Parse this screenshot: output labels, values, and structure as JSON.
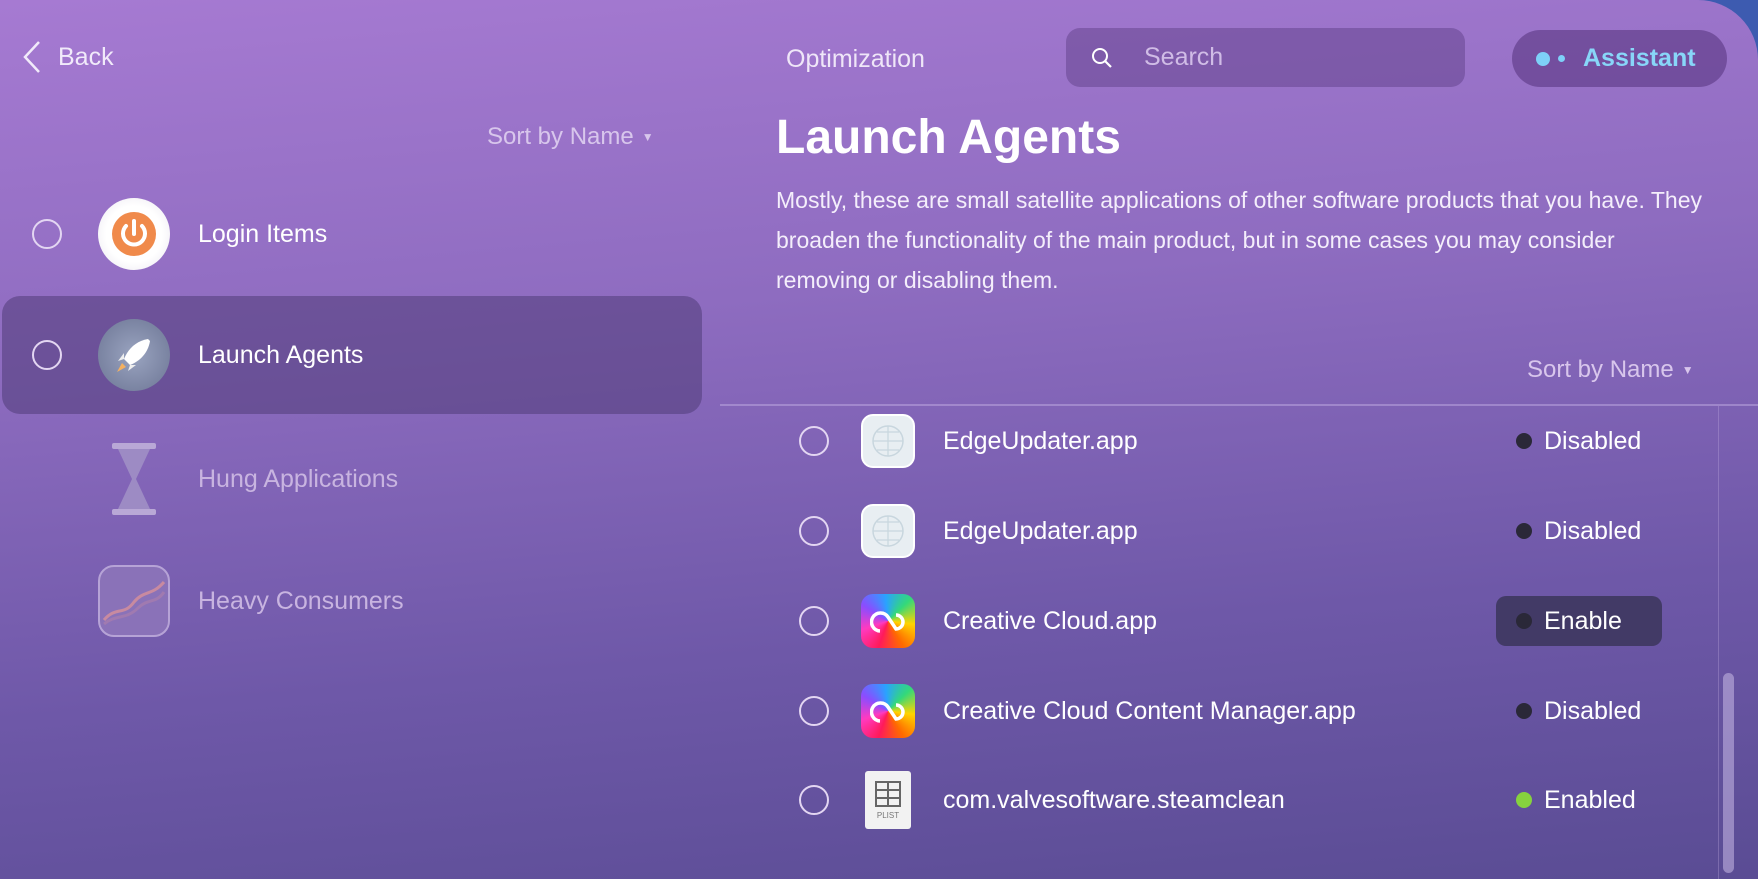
{
  "header": {
    "back_label": "Back",
    "section": "Optimization",
    "search_placeholder": "Search",
    "assistant_label": "Assistant"
  },
  "sidebar": {
    "sort_label": "Sort by Name",
    "items": [
      {
        "label": "Login Items",
        "icon": "power-icon",
        "selected": false,
        "dimmed": false
      },
      {
        "label": "Launch Agents",
        "icon": "rocket-icon",
        "selected": true,
        "dimmed": false
      },
      {
        "label": "Hung Applications",
        "icon": "hourglass-icon",
        "selected": false,
        "dimmed": true
      },
      {
        "label": "Heavy Consumers",
        "icon": "chart-icon",
        "selected": false,
        "dimmed": true
      }
    ]
  },
  "main": {
    "title": "Launch Agents",
    "description": "Mostly, these are small satellite applications of other software products that you have. They broaden the functionality of the main product, but in some cases you may consider removing or disabling them.",
    "sort_label": "Sort by Name",
    "items": [
      {
        "name": "EdgeUpdater.app",
        "status": "Disabled",
        "icon": "edge-updater-icon"
      },
      {
        "name": "EdgeUpdater.app",
        "status": "Disabled",
        "icon": "edge-updater-icon"
      },
      {
        "name": "Creative Cloud.app",
        "status": "Enable",
        "icon": "creative-cloud-icon"
      },
      {
        "name": "Creative Cloud Content Manager.app",
        "status": "Disabled",
        "icon": "creative-cloud-icon"
      },
      {
        "name": "com.valvesoftware.steamclean",
        "status": "Enabled",
        "icon": "plist-file-icon",
        "plist_label": "PLIST"
      }
    ]
  },
  "colors": {
    "enabled": "#86d23e",
    "disabled": "#2a2838",
    "assistant": "#88d6f8"
  }
}
